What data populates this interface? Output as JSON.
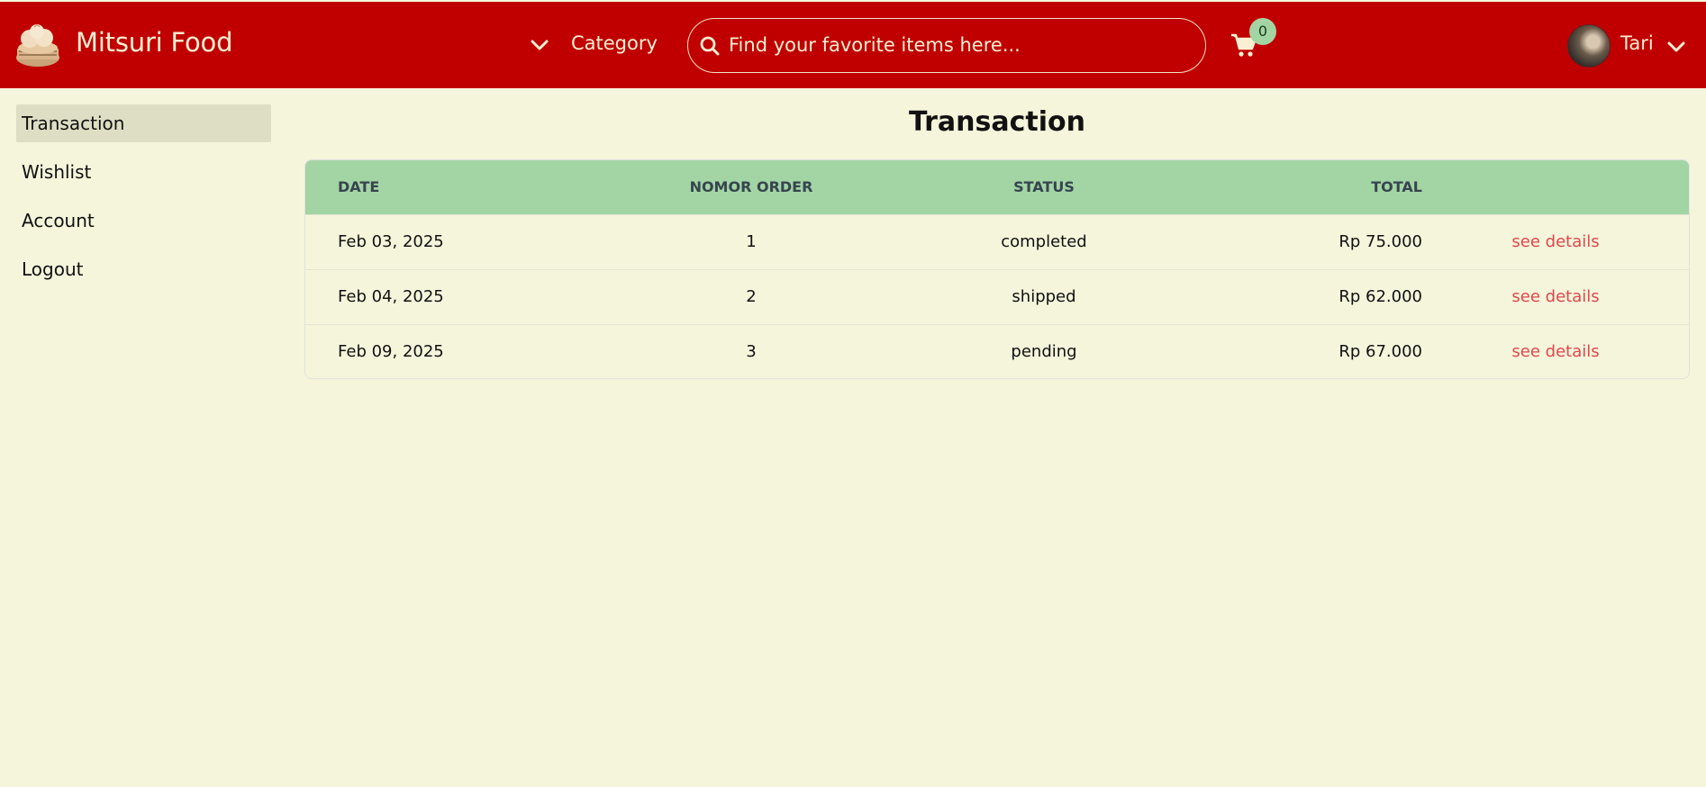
{
  "header": {
    "brand": "Mitsuri Food",
    "category_label": "Category",
    "search_placeholder": "Find your favorite items here...",
    "cart_count": "0",
    "username": "Tari"
  },
  "sidebar": {
    "items": [
      {
        "label": "Transaction",
        "active": true
      },
      {
        "label": "Wishlist"
      },
      {
        "label": "Account"
      },
      {
        "label": "Logout"
      }
    ]
  },
  "main": {
    "title": "Transaction",
    "table": {
      "columns": [
        "DATE",
        "NOMOR ORDER",
        "STATUS",
        "TOTAL",
        ""
      ],
      "rows": [
        {
          "date": "Feb 03, 2025",
          "order": "1",
          "status": "completed",
          "total": "Rp 75.000",
          "action": "see details"
        },
        {
          "date": "Feb 04, 2025",
          "order": "2",
          "status": "shipped",
          "total": "Rp 62.000",
          "action": "see details"
        },
        {
          "date": "Feb 09, 2025",
          "order": "3",
          "status": "pending",
          "total": "Rp 67.000",
          "action": "see details"
        }
      ]
    }
  },
  "colors": {
    "header_bg": "#c00000",
    "page_bg": "#f5f5dc",
    "table_header_bg": "#a3d4a4",
    "link": "#e0474c"
  }
}
